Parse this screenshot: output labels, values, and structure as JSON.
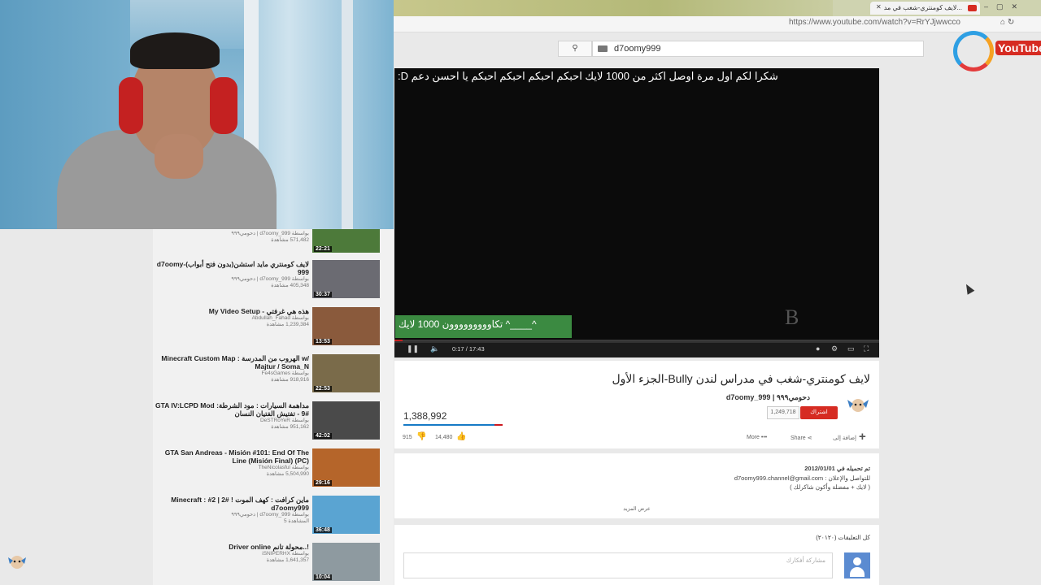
{
  "browser": {
    "tab_title": "لايف كومنتري-شغب في مد...",
    "url": "https://www.youtube.com/watch?v=RrYJjwwcco"
  },
  "logo_text": "YouTube",
  "search": {
    "value": "d7oomy999",
    "button_icon": "search-icon"
  },
  "player": {
    "overlay_text": "شكرا لكم اول مرة اوصل اكثر من 1000 لايك احبكم احبكم احبكم احبكم يا احسن دعم D:",
    "annotation": "تكاووووووووون 1000 لايك ^____^",
    "watermark": "B",
    "current_time": "0:17",
    "duration": "17:43",
    "progress_fraction": 0.016
  },
  "video": {
    "title": "لايف كومنتري-شغب في مدراس لندن Bully-الجزء الأول",
    "channel": "d7oomy_999 | دحومي٩٩٩",
    "subscribe_label": "اشتراك",
    "subscriber_count": "1,249,718",
    "views": "1,388,992",
    "likes": "14,480",
    "dislikes": "915",
    "more_label": "More",
    "share_label": "Share",
    "add_label": "إضافة إلى"
  },
  "description": {
    "published": "تم تحميله في 2012/01/01",
    "line1": "للتواصل والإعلان : d7oomy999.channel@gmail.com",
    "line2": "( لايك + مفضلة وأكون شاكرلك )",
    "show_more": "عرض المزيد"
  },
  "comments": {
    "header": "كل التعليقات (٢٠١٢٠)",
    "placeholder": "مشاركة أفكارك"
  },
  "related": [
    {
      "title": "",
      "channel": "بواسطة d7oomy_999 | دحومي٩٩٩",
      "views": "571,482 مشاهدة",
      "duration": "22:21",
      "thumb": "#4d7a3a"
    },
    {
      "title": "لايف كومنتري مايد استشن(بدون فتح أبواب)-d7oomy 999",
      "channel": "بواسطة d7oomy_999 | دحومي٩٩٩",
      "views": "405,348 مشاهدة",
      "duration": "30:37",
      "thumb": "#6b6b72"
    },
    {
      "title": "هذه هي غرفتي - My Video Setup",
      "channel": "بواسطة Abdullah_Fahad",
      "views": "1,239,384 مشاهدة",
      "duration": "13:53",
      "thumb": "#8a5a3c"
    },
    {
      "title": "Minecraft Custom Map : الهروب من المدرسة w/ Majtur / Soma_N",
      "channel": "بواسطة Fe4sGames",
      "views": "918,916 مشاهدة",
      "duration": "22:53",
      "thumb": "#7a6b4a"
    },
    {
      "title": "GTA IV:LCPD Mod :مداهمة السيارات : مود الشرطة #9 - تفتيش الفتيان النسان",
      "channel": "بواسطة DeSTRoYeR",
      "views": "951,162 مشاهدة",
      "duration": "42:02",
      "thumb": "#4a4a4a"
    },
    {
      "title": "GTA San Andreas - Misión #101: End Of The Line (Misión Final) (PC)",
      "channel": "بواسطة TheNicolasful",
      "views": "5,504,990 مشاهدة",
      "duration": "29:16",
      "thumb": "#b5652a"
    },
    {
      "title": "ماين كرافت : كهف الموت ! #2 | Minecraft : #2 d7oomy999",
      "channel": "بواسطة d7oomy_999 | دحومي٩٩٩",
      "views": "المشاهدة 5",
      "duration": "36:48",
      "thumb": "#5aa4d2"
    },
    {
      "title": "!..محولة تانم Driver online",
      "channel": "بواسطة iSNIPERHX",
      "views": "1,641,357 مشاهدة",
      "duration": "10:04",
      "thumb": "#8e9aa0"
    }
  ],
  "colors": {
    "youtube_red": "#d62b22",
    "annotation_green": "#3b8a41",
    "view_bar_blue": "#167ac6"
  }
}
